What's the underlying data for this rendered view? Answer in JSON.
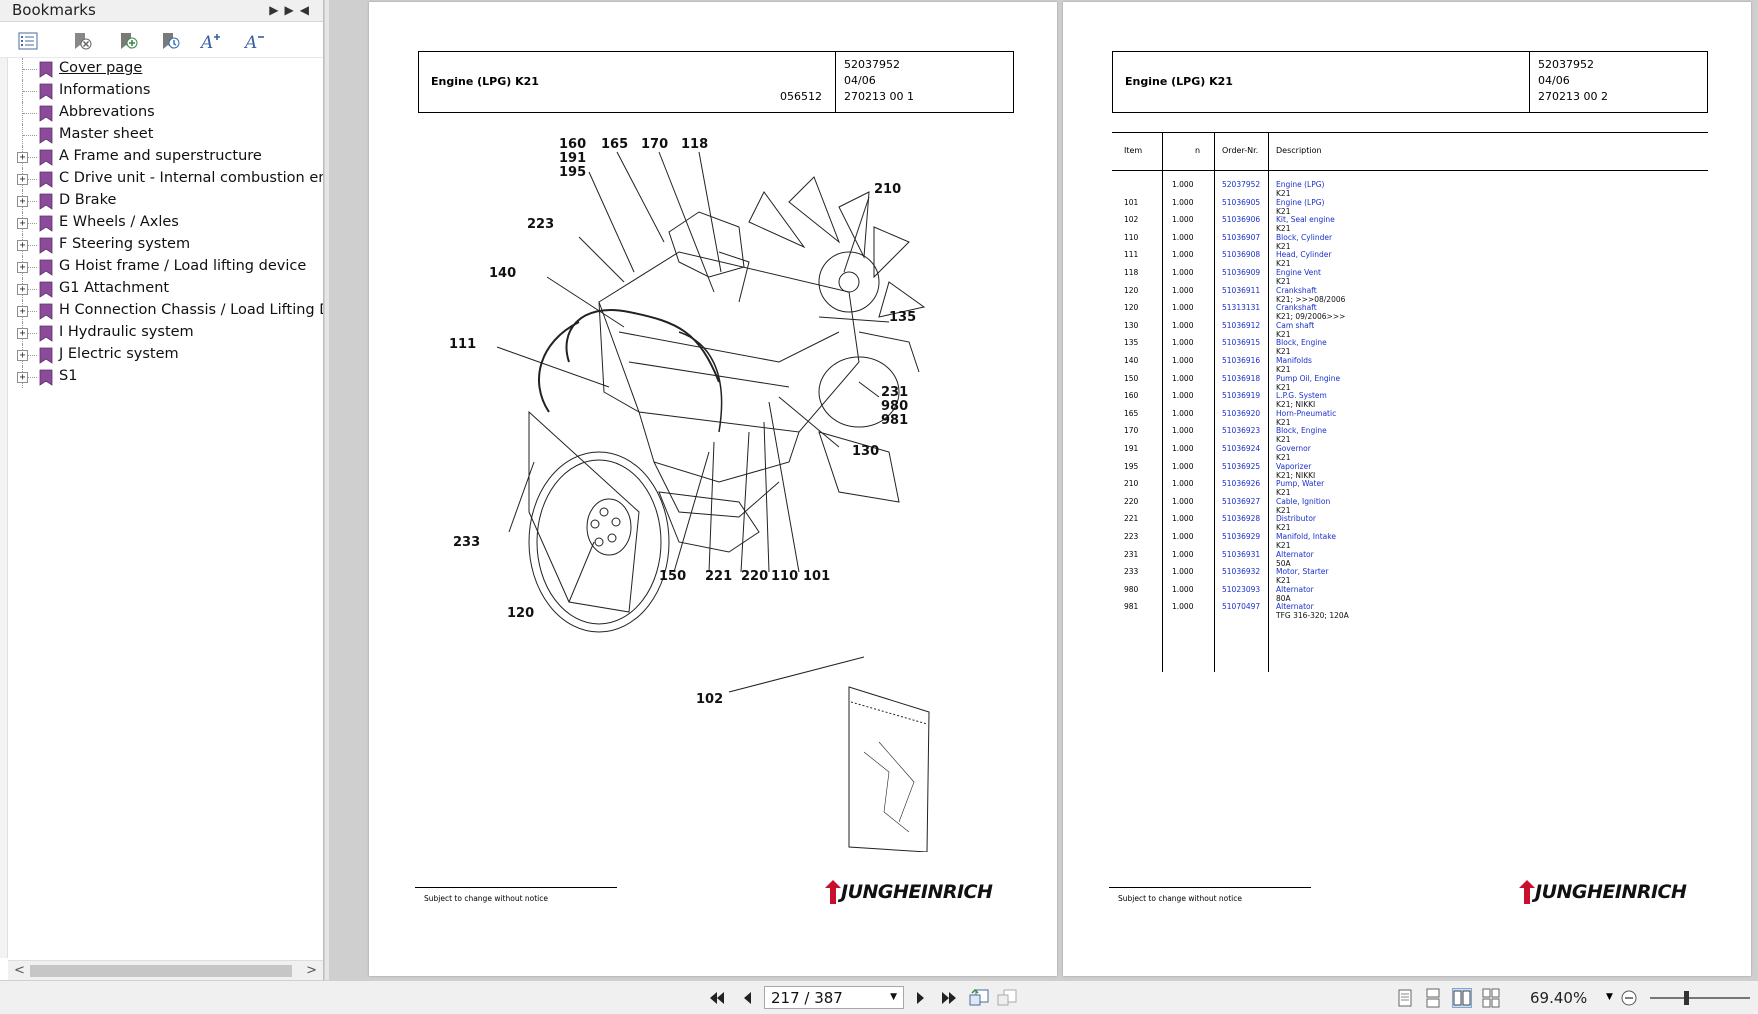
{
  "sidebar": {
    "title": "Bookmarks",
    "tools": [
      {
        "name": "options-icon"
      },
      {
        "name": "delete-bookmark-icon"
      },
      {
        "name": "add-bookmark-icon"
      },
      {
        "name": "bookmark-properties-icon"
      },
      {
        "name": "increase-font-icon"
      },
      {
        "name": "decrease-font-icon"
      }
    ],
    "items": [
      {
        "label": "Cover page",
        "expandable": false,
        "link": true
      },
      {
        "label": "Informations",
        "expandable": false,
        "link": false
      },
      {
        "label": "Abbrevations",
        "expandable": false,
        "link": false
      },
      {
        "label": "Master sheet",
        "expandable": false,
        "link": false
      },
      {
        "label": "A Frame and superstructure",
        "expandable": true,
        "link": false
      },
      {
        "label": "C Drive unit - Internal combustion engine",
        "expandable": true,
        "link": false
      },
      {
        "label": "D Brake",
        "expandable": true,
        "link": false
      },
      {
        "label": "E Wheels / Axles",
        "expandable": true,
        "link": false
      },
      {
        "label": "F Steering system",
        "expandable": true,
        "link": false
      },
      {
        "label": "G Hoist frame / Load lifting device",
        "expandable": true,
        "link": false
      },
      {
        "label": "G1 Attachment",
        "expandable": true,
        "link": false
      },
      {
        "label": "H Connection Chassis / Load Lifting Device",
        "expandable": true,
        "link": false
      },
      {
        "label": "I Hydraulic system",
        "expandable": true,
        "link": false
      },
      {
        "label": "J Electric system",
        "expandable": true,
        "link": false
      },
      {
        "label": "S1",
        "expandable": true,
        "link": false
      }
    ]
  },
  "page_left": {
    "title": "Engine (LPG) K21",
    "subcode": "056512",
    "meta": [
      "52037952",
      "04/06",
      "270213 00 1"
    ],
    "callouts": [
      "160",
      "191",
      "195",
      "165",
      "170",
      "118",
      "210",
      "223",
      "140",
      "135",
      "111",
      "231",
      "980",
      "981",
      "130",
      "233",
      "150",
      "221",
      "220",
      "110",
      "101",
      "120",
      "102"
    ],
    "footer": "Subject to change without notice",
    "logo": "JUNGHEINRICH"
  },
  "page_right": {
    "title": "Engine (LPG) K21",
    "meta": [
      "52037952",
      "04/06",
      "270213 00 2"
    ],
    "columns": {
      "item": "Item",
      "n": "n",
      "order": "Order-Nr.",
      "desc": "Description"
    },
    "rows": [
      {
        "item": "",
        "n": "1.000",
        "order": "52037952",
        "desc": "Engine (LPG)",
        "sub": "K21"
      },
      {
        "item": "101",
        "n": "1.000",
        "order": "51036905",
        "desc": "Engine (LPG)",
        "sub": "K21"
      },
      {
        "item": "102",
        "n": "1.000",
        "order": "51036906",
        "desc": "Kit, Seal engine",
        "sub": "K21"
      },
      {
        "item": "110",
        "n": "1.000",
        "order": "51036907",
        "desc": "Block, Cylinder",
        "sub": "K21"
      },
      {
        "item": "111",
        "n": "1.000",
        "order": "51036908",
        "desc": "Head, Cylinder",
        "sub": "K21"
      },
      {
        "item": "118",
        "n": "1.000",
        "order": "51036909",
        "desc": "Engine Vent",
        "sub": "K21"
      },
      {
        "item": "120",
        "n": "1.000",
        "order": "51036911",
        "desc": "Crankshaft",
        "sub": "K21;  >>>08/2006"
      },
      {
        "item": "120",
        "n": "1.000",
        "order": "51313131",
        "desc": "Crankshaft",
        "sub": "K21;  09/2006>>>"
      },
      {
        "item": "130",
        "n": "1.000",
        "order": "51036912",
        "desc": "Cam shaft",
        "sub": "K21"
      },
      {
        "item": "135",
        "n": "1.000",
        "order": "51036915",
        "desc": "Block, Engine",
        "sub": "K21"
      },
      {
        "item": "140",
        "n": "1.000",
        "order": "51036916",
        "desc": "Manifolds",
        "sub": "K21"
      },
      {
        "item": "150",
        "n": "1.000",
        "order": "51036918",
        "desc": "Pump Oil, Engine",
        "sub": "K21"
      },
      {
        "item": "160",
        "n": "1.000",
        "order": "51036919",
        "desc": "L.P.G. System",
        "sub": "K21; NIKKI"
      },
      {
        "item": "165",
        "n": "1.000",
        "order": "51036920",
        "desc": "Horn-Pneumatic",
        "sub": "K21"
      },
      {
        "item": "170",
        "n": "1.000",
        "order": "51036923",
        "desc": "Block, Engine",
        "sub": "K21"
      },
      {
        "item": "191",
        "n": "1.000",
        "order": "51036924",
        "desc": "Governor",
        "sub": "K21"
      },
      {
        "item": "195",
        "n": "1.000",
        "order": "51036925",
        "desc": "Vaporizer",
        "sub": "K21; NIKKI"
      },
      {
        "item": "210",
        "n": "1.000",
        "order": "51036926",
        "desc": "Pump, Water",
        "sub": "K21"
      },
      {
        "item": "220",
        "n": "1.000",
        "order": "51036927",
        "desc": "Cable, Ignition",
        "sub": "K21"
      },
      {
        "item": "221",
        "n": "1.000",
        "order": "51036928",
        "desc": "Distributor",
        "sub": "K21"
      },
      {
        "item": "223",
        "n": "1.000",
        "order": "51036929",
        "desc": "Manifold, Intake",
        "sub": "K21"
      },
      {
        "item": "231",
        "n": "1.000",
        "order": "51036931",
        "desc": "Alternator",
        "sub": "50A"
      },
      {
        "item": "233",
        "n": "1.000",
        "order": "51036932",
        "desc": "Motor, Starter",
        "sub": "K21"
      },
      {
        "item": "980",
        "n": "1.000",
        "order": "51023093",
        "desc": "Alternator",
        "sub": "80A"
      },
      {
        "item": "981",
        "n": "1.000",
        "order": "51070497",
        "desc": "Alternator",
        "sub": "TFG 316-320; 120A"
      }
    ],
    "footer": "Subject to change without notice",
    "logo": "JUNGHEINRICH"
  },
  "toolbar": {
    "page_indicator": "217 / 387",
    "zoom": "69.40%"
  },
  "colors": {
    "bookmark": "#8b4a9a",
    "link": "#1a2fcc"
  }
}
